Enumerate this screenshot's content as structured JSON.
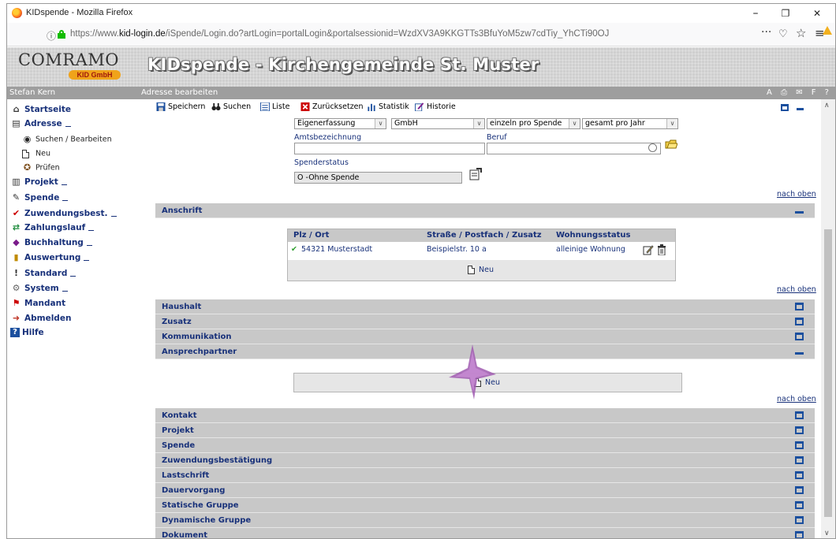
{
  "window": {
    "title": "KIDspende - Mozilla Firefox",
    "minimize": "–",
    "restore": "❐",
    "close": "✕"
  },
  "address_bar": {
    "url_prefix": "https://www.",
    "url_domain": "kid-login.de",
    "url_rest": "/iSpende/Login.do?artLogin=portalLogin&portalsessionid=WzdXV3A9KKGTTs3BfuYoM5zw7cdTiy_YhCTi90OJ",
    "more": "···",
    "pocket": "♡",
    "bookmark": "☆",
    "menu": "≡"
  },
  "header": {
    "logo_text": "COMRAMO",
    "logo_sub": "KID GmbH",
    "app_title": "KIDspende - Kirchengemeinde St. Muster"
  },
  "strip": {
    "user": "Stefan Kern",
    "context": "Adresse bearbeiten",
    "tools": "A ⎙ ✉ F ?"
  },
  "sidebar": {
    "items": [
      {
        "label": "Startseite",
        "icon": "home-icon",
        "glyph": "⌂",
        "color": "#333"
      },
      {
        "label": "Adresse",
        "icon": "address-book-icon",
        "glyph": "▤",
        "color": "#333"
      },
      {
        "label": "Suchen / Bearbeiten",
        "icon": "binoculars-icon",
        "glyph": "◉",
        "color": "#222"
      },
      {
        "label": "Neu",
        "icon": "new-document-icon",
        "glyph": "",
        "color": "#333"
      },
      {
        "label": "Prüfen",
        "icon": "check-person-icon",
        "glyph": "✪",
        "color": "#7a4b18"
      },
      {
        "label": "Projekt",
        "icon": "project-icon",
        "glyph": "▥",
        "color": "#333"
      },
      {
        "label": "Spende",
        "icon": "donation-icon",
        "glyph": "✎",
        "color": "#333"
      },
      {
        "label": "Zuwendungsbest.",
        "icon": "receipt-icon",
        "glyph": "✔",
        "color": "#c00"
      },
      {
        "label": "Zahlungslauf",
        "icon": "payment-icon",
        "glyph": "⇄",
        "color": "#1b8a3a"
      },
      {
        "label": "Buchhaltung",
        "icon": "accounting-icon",
        "glyph": "◆",
        "color": "#7a1b8a"
      },
      {
        "label": "Auswertung",
        "icon": "report-icon",
        "glyph": "▮",
        "color": "#c08a00"
      },
      {
        "label": "Standard",
        "icon": "standard-icon",
        "glyph": "!",
        "color": "#333"
      },
      {
        "label": "System",
        "icon": "gear-icon",
        "glyph": "⚙",
        "color": "#666"
      },
      {
        "label": "Mandant",
        "icon": "client-icon",
        "glyph": "⚑",
        "color": "#c00"
      },
      {
        "label": "Abmelden",
        "icon": "logout-icon",
        "glyph": "➜",
        "color": "#c0392b"
      },
      {
        "label": "Hilfe",
        "icon": "help-icon",
        "glyph": "?",
        "color": "#fff"
      }
    ]
  },
  "toolbar": {
    "save": "Speichern",
    "search": "Suchen",
    "list": "Liste",
    "reset": "Zurücksetzen",
    "stats": "Statistik",
    "history": "Historie"
  },
  "form": {
    "eigenerfassung": "Eigenerfassung",
    "gmbh": "GmbH",
    "einzeln": "einzeln pro Spende",
    "gesamt": "gesamt pro Jahr",
    "amtsbezeichnung_label": "Amtsbezeichnung",
    "amtsbezeichnung_value": "",
    "beruf_label": "Beruf",
    "beruf_value": "",
    "spenderstatus_label": "Spenderstatus",
    "spenderstatus_value": "O -Ohne Spende",
    "nach_oben": "nach oben"
  },
  "anschrift": {
    "title": "Anschrift",
    "columns": [
      "Plz / Ort",
      "Straße / Postfach / Zusatz",
      "Wohnungsstatus"
    ],
    "rows": [
      {
        "plz_ort": "54321 Musterstadt",
        "strasse": "Beispielstr. 10 a",
        "status": "alleinige Wohnung"
      }
    ],
    "neu": "Neu"
  },
  "sections": {
    "haushalt": "Haushalt",
    "zusatz": "Zusatz",
    "kommunikation": "Kommunikation",
    "ansprechpartner": "Ansprechpartner",
    "ansprechpartner_neu": "Neu",
    "kontakt": "Kontakt",
    "projekt": "Projekt",
    "spende": "Spende",
    "zuwendung": "Zuwendungsbestätigung",
    "lastschrift": "Lastschrift",
    "dauervorgang": "Dauervorgang",
    "statische": "Statische Gruppe",
    "dynamische": "Dynamische Gruppe",
    "dokument": "Dokument"
  },
  "colors": {
    "accent": "#18317a",
    "section_bg": "#c8c8c8",
    "icon_blue": "#1b4f9e",
    "cursor": "#a05ab0"
  }
}
